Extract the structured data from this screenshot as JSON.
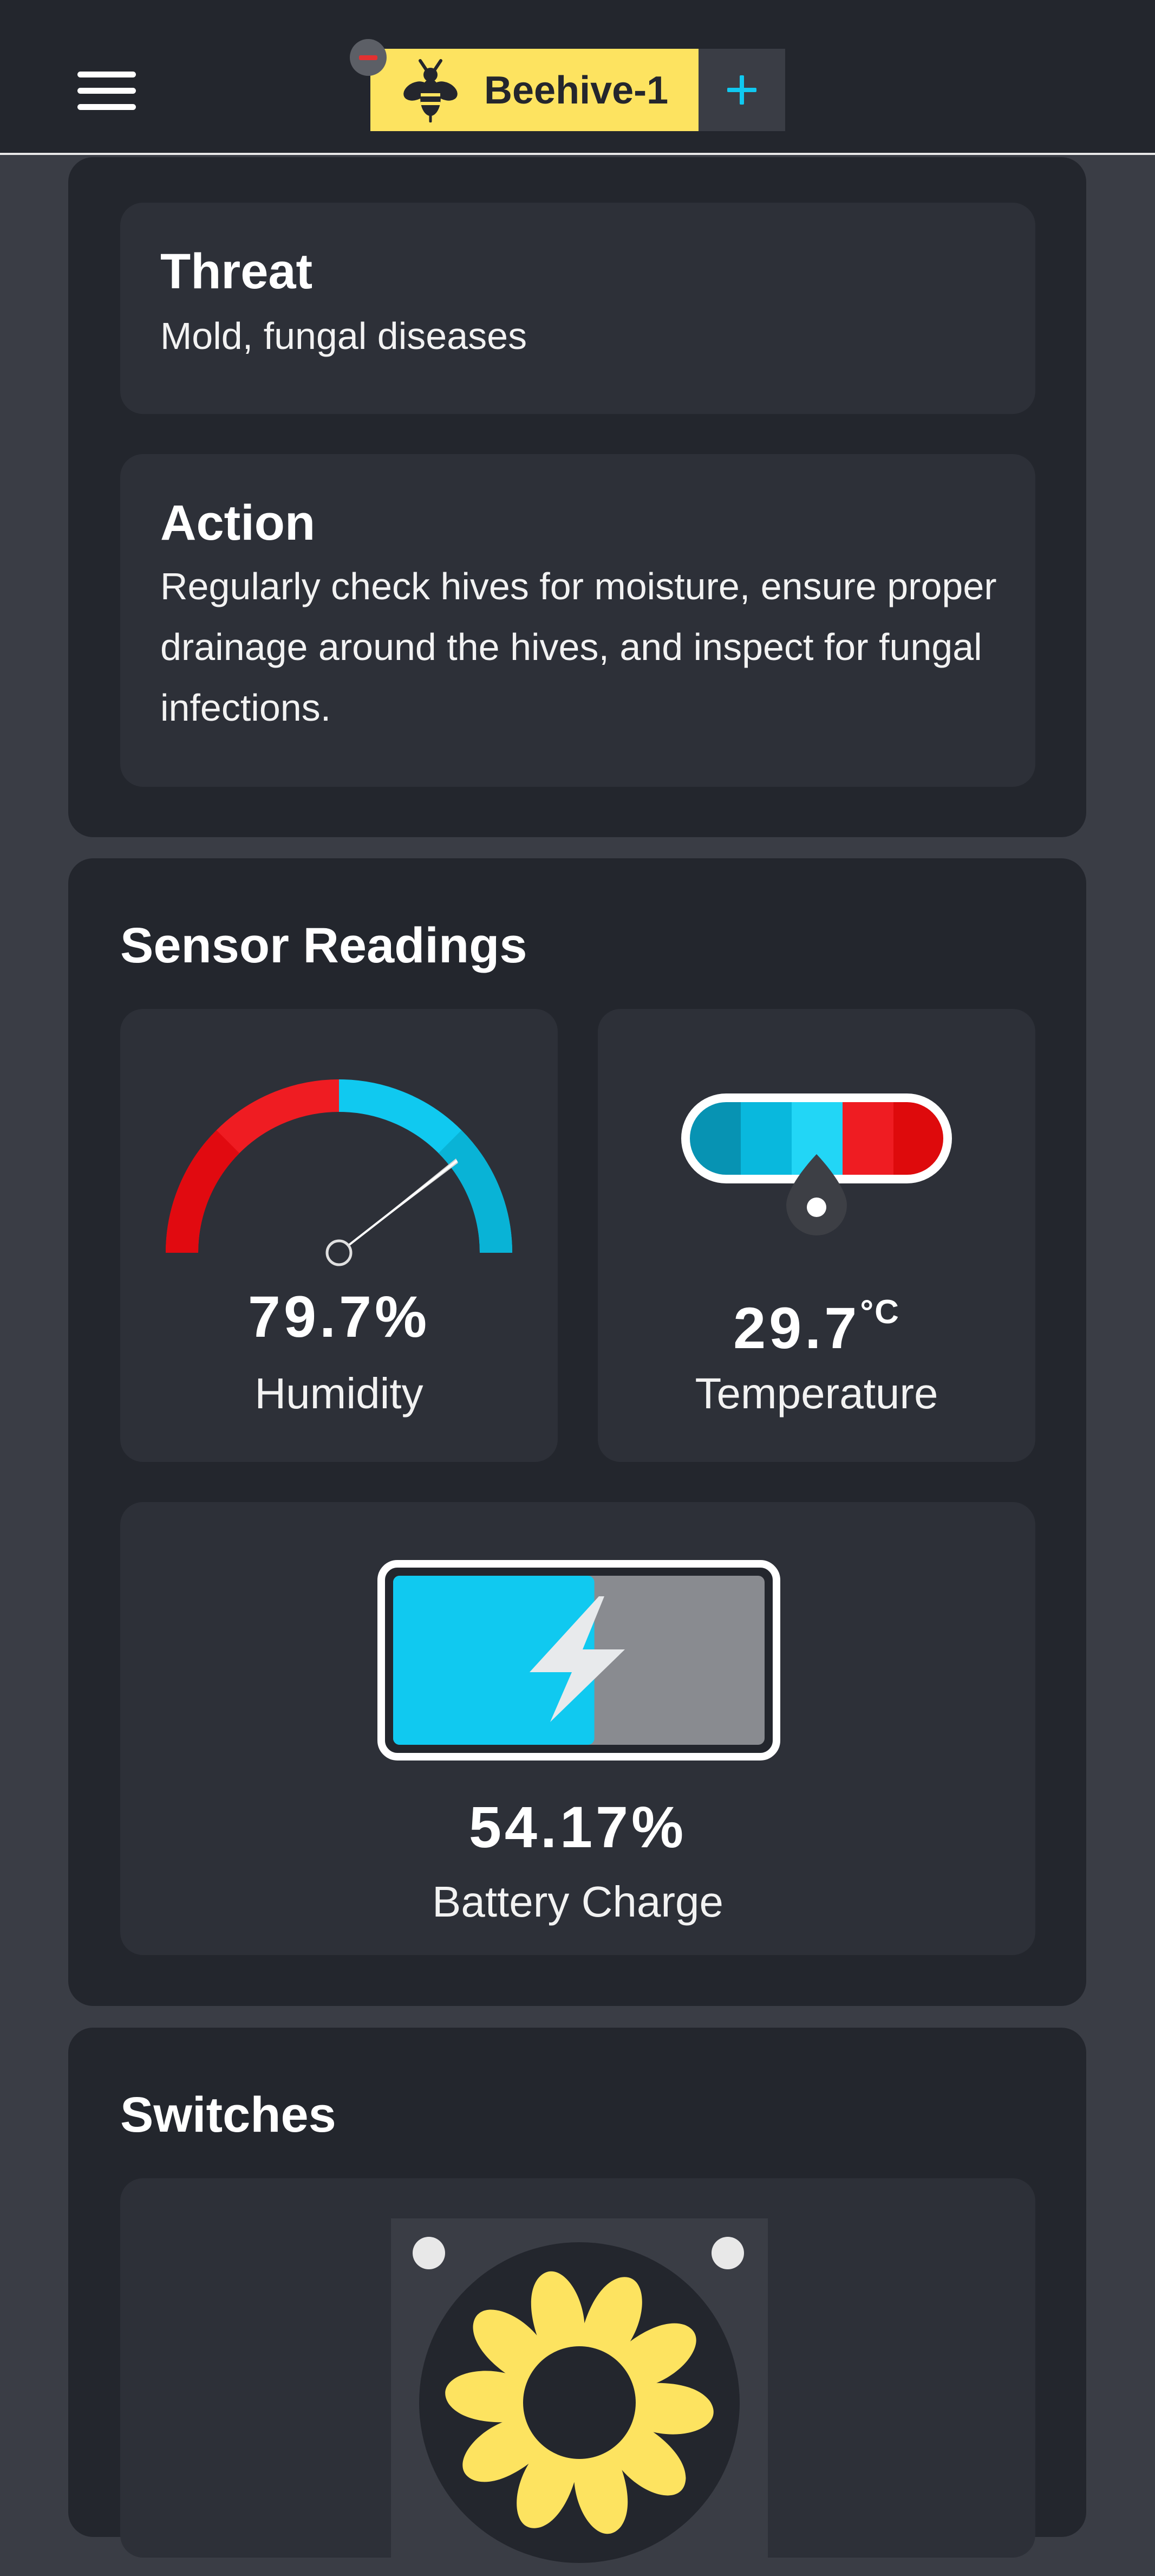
{
  "header": {
    "menu_icon": "hamburger-menu-icon",
    "tab_label": "Beehive-1",
    "tab_icon": "bee-icon",
    "remove_icon": "minus-icon",
    "add_icon": "plus-icon",
    "colors": {
      "tab_bg": "#fde360",
      "remove": "#e23131",
      "add": "#10c9f0"
    }
  },
  "alert": {
    "threat_title": "Threat",
    "threat_text": "Mold, fungal diseases",
    "action_title": "Action",
    "action_text": "Regularly check hives for moisture, ensure proper drainage around the hives, and inspect for fungal infections."
  },
  "sensors": {
    "title": "Sensor Readings",
    "humidity": {
      "value": "79.7%",
      "label": "Humidity",
      "level": 0.797,
      "icon": "humidity-gauge-icon"
    },
    "temperature": {
      "value": "29.7",
      "unit": "°C",
      "label": "Temperature",
      "icon": "thermometer-icon"
    },
    "battery": {
      "value": "54.17%",
      "label": "Battery Charge",
      "level": 0.5417,
      "icon": "battery-charging-icon"
    }
  },
  "switches": {
    "title": "Switches",
    "fan_icon": "fan-icon"
  },
  "colors": {
    "background": "#3a3d45",
    "panel": "#23262d",
    "card": "#2d3038",
    "accent_blue": "#10c9f0",
    "accent_red": "#ef1c22",
    "fan_yellow": "#fde360"
  }
}
